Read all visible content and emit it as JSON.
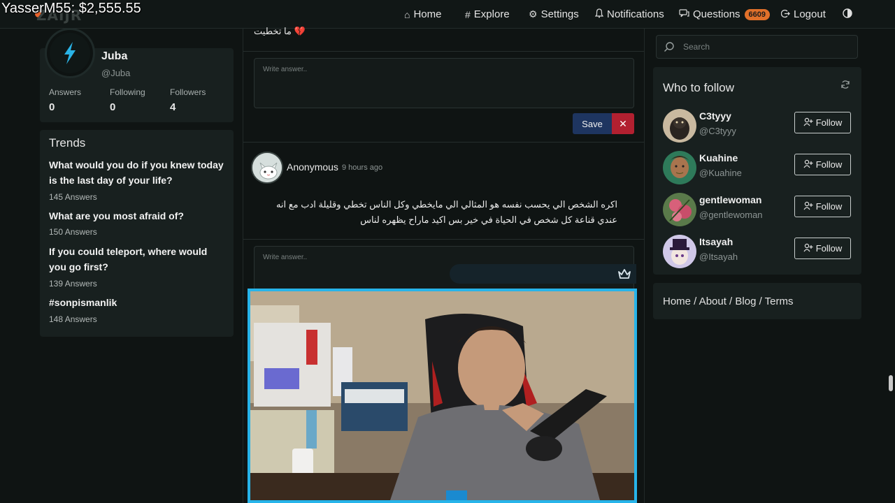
{
  "overlay": {
    "text": "YasserM55: $2,555.55"
  },
  "brand": {
    "logo_text": "ZAIJR",
    "accent": "#e8632b"
  },
  "nav": {
    "home": "Home",
    "explore": "Explore",
    "settings": "Settings",
    "notifications": "Notifications",
    "questions": "Questions",
    "questions_count": "6609",
    "logout": "Logout"
  },
  "profile": {
    "name": "Juba",
    "handle": "@Juba",
    "stats": [
      {
        "label": "Answers",
        "value": "0"
      },
      {
        "label": "Following",
        "value": "0"
      },
      {
        "label": "Followers",
        "value": "4"
      }
    ]
  },
  "trends": {
    "title": "Trends",
    "items": [
      {
        "question": "What would you do if you knew today is the last day of your life?",
        "answers": "145 Answers"
      },
      {
        "question": "What are you most afraid of?",
        "answers": "150 Answers"
      },
      {
        "question": "If you could teleport, where would you go first?",
        "answers": "139 Answers"
      },
      {
        "question": "#sonpismanlik",
        "answers": "148 Answers"
      }
    ]
  },
  "feed": {
    "top_text": "💔 ما تخطيت",
    "answer_placeholder": "Write answer..",
    "save_label": "Save",
    "cancel_label": "✕",
    "post": {
      "author": "Anonymous",
      "time": "9 hours ago",
      "text": "اكره الشخص الي يحسب نفسه هو المثالي الي مايخطي وكل الناس تخطي وقليلة ادب مع انه عندي قناعة كل شخص في الحياة في خير بس اكيد ماراح يظهره لناس"
    },
    "answer_placeholder_2": "Write answer.."
  },
  "sidebar": {
    "search_placeholder": "Search",
    "who_to_follow_title": "Who to follow",
    "follow_label": "Follow",
    "users": [
      {
        "name": "C3tyyy",
        "handle": "@C3tyyy"
      },
      {
        "name": "Kuahine",
        "handle": "@Kuahine"
      },
      {
        "name": "gentlewoman",
        "handle": "@gentlewoman"
      },
      {
        "name": "Itsayah",
        "handle": "@Itsayah"
      }
    ],
    "footer": "Home / About / Blog / Terms"
  },
  "colors": {
    "background": "#0f1413",
    "card": "#18201f",
    "save_button": "#1e3560",
    "cancel_button": "#b22030",
    "badge": "#e0702a",
    "webcam_border": "#27b4ea"
  }
}
